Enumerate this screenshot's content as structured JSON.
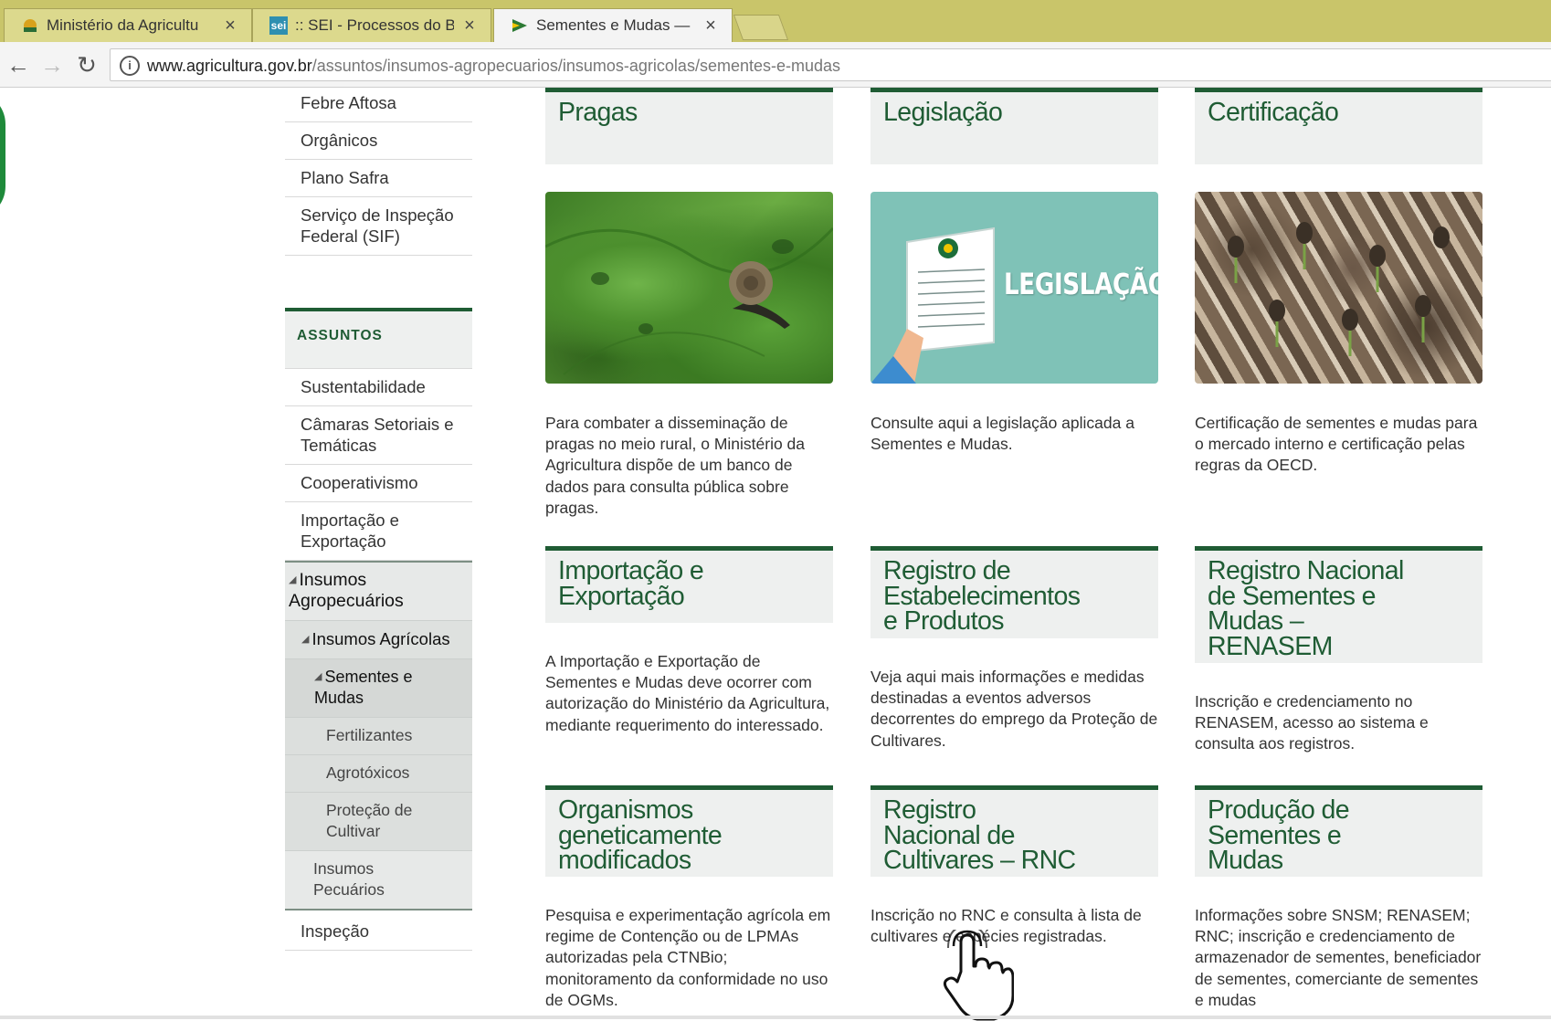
{
  "browser": {
    "tabs": [
      {
        "title": "Ministério da Agricultu",
        "favicon": "brasil-coat-icon"
      },
      {
        "title": ":: SEI - Processos do Bl",
        "favicon": "sei-icon",
        "favicon_text": "sei"
      },
      {
        "title": "Sementes e Mudas — ",
        "favicon": "flag-icon",
        "active": true
      }
    ],
    "close_symbol": "×",
    "url_host": "www.agricultura.gov.br",
    "url_path": "/assuntos/insumos-agropecuarios/insumos-agricolas/sementes-e-mudas"
  },
  "sidebar": {
    "top_links": [
      "Febre Aftosa",
      "Orgânicos",
      "Plano Safra",
      "Serviço de Inspeção Federal (SIF)"
    ],
    "section_title": "ASSUNTOS",
    "links": [
      "Sustentabilidade",
      "Câmaras Setoriais e Temáticas",
      "Cooperativismo",
      "Importação e Exportação"
    ],
    "group": {
      "level1": "Insumos Agropecuários",
      "level2": "Insumos Agrícolas",
      "level3_active": "Sementes e Mudas",
      "level3_items": [
        "Fertilizantes",
        "Agrotóxicos",
        "Proteção de Cultivar"
      ],
      "level2_other": "Insumos Pecuários"
    },
    "after_group": [
      "Inspeção"
    ]
  },
  "cards": {
    "row1": [
      {
        "title": "Pragas",
        "text": "Para combater a disseminação de pragas no meio rural, o Ministério da Agricultura dispõe de um banco de dados para consulta pública sobre pragas."
      },
      {
        "title": "Legislação",
        "image_label": "LEGISLAÇÃO",
        "text": "Consulte aqui a legislação aplicada a Sementes e Mudas."
      },
      {
        "title": "Certificação",
        "text": "Certificação de sementes e mudas para o mercado interno e certificação pelas regras da OECD."
      }
    ],
    "row2": [
      {
        "title": "Importação e Exportação",
        "text": "A Importação e Exportação de Sementes e Mudas deve ocorrer com autorização do Ministério da Agricultura, mediante requerimento do interessado."
      },
      {
        "title": "Registro de Estabelecimentos e Produtos",
        "text": "Veja aqui mais informações e medidas destinadas a  eventos adversos decorrentes do emprego da Proteção de Cultivares."
      },
      {
        "title": "Registro Nacional de Sementes e Mudas – RENASEM",
        "text": "Inscrição e credenciamento no RENASEM, acesso ao sistema e consulta aos registros."
      }
    ],
    "row3": [
      {
        "title": "Organismos geneticamente modificados",
        "text": "Pesquisa e experimentação agrícola em regime de Contenção ou de LPMAs autorizadas pela CTNBio; monitoramento da conformidade no uso de OGMs."
      },
      {
        "title": "Registro Nacional de Cultivares – RNC",
        "text": "Inscrição no RNC e consulta à lista de cultivares e espécies registradas."
      },
      {
        "title": "Produção de Sementes e Mudas",
        "text": "Informações sobre SNSM; RENASEM; RNC; inscrição e credenciamento de armazenador de sementes, beneficiador de sementes, comerciante de sementes e mudas"
      }
    ]
  }
}
